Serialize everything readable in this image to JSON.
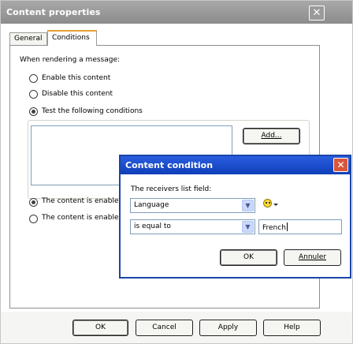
{
  "main_window": {
    "title": "Content properties",
    "tabs": [
      {
        "label": "General"
      },
      {
        "label": "Conditions"
      }
    ],
    "intro_label": "When rendering a message:",
    "radios": [
      {
        "label": "Enable this content"
      },
      {
        "label": "Disable this content"
      },
      {
        "label": "Test the following conditions"
      }
    ],
    "add_button": "Add...",
    "enabled_radios": [
      {
        "label": "The content is enabled"
      },
      {
        "label": "The content is enabled"
      }
    ],
    "footer_buttons": {
      "ok": "OK",
      "cancel": "Cancel",
      "apply": "Apply",
      "help": "Help"
    }
  },
  "dialog": {
    "title": "Content condition",
    "field_label": "The receivers list field:",
    "field_value": "Language",
    "operator_value": "is equal to",
    "text_value": "French",
    "ok_label": "OK",
    "cancel_label": "Annuler"
  },
  "colors": {
    "main_title_bg": "#9a9a9a",
    "dialog_title_bg": "#1f4fd0",
    "dialog_close_bg": "#d8573b",
    "tab_accent": "#e8a030"
  },
  "icons": {
    "close": "close-icon",
    "dropdown": "chevron-down-icon",
    "personalization": "smiley-icon"
  }
}
